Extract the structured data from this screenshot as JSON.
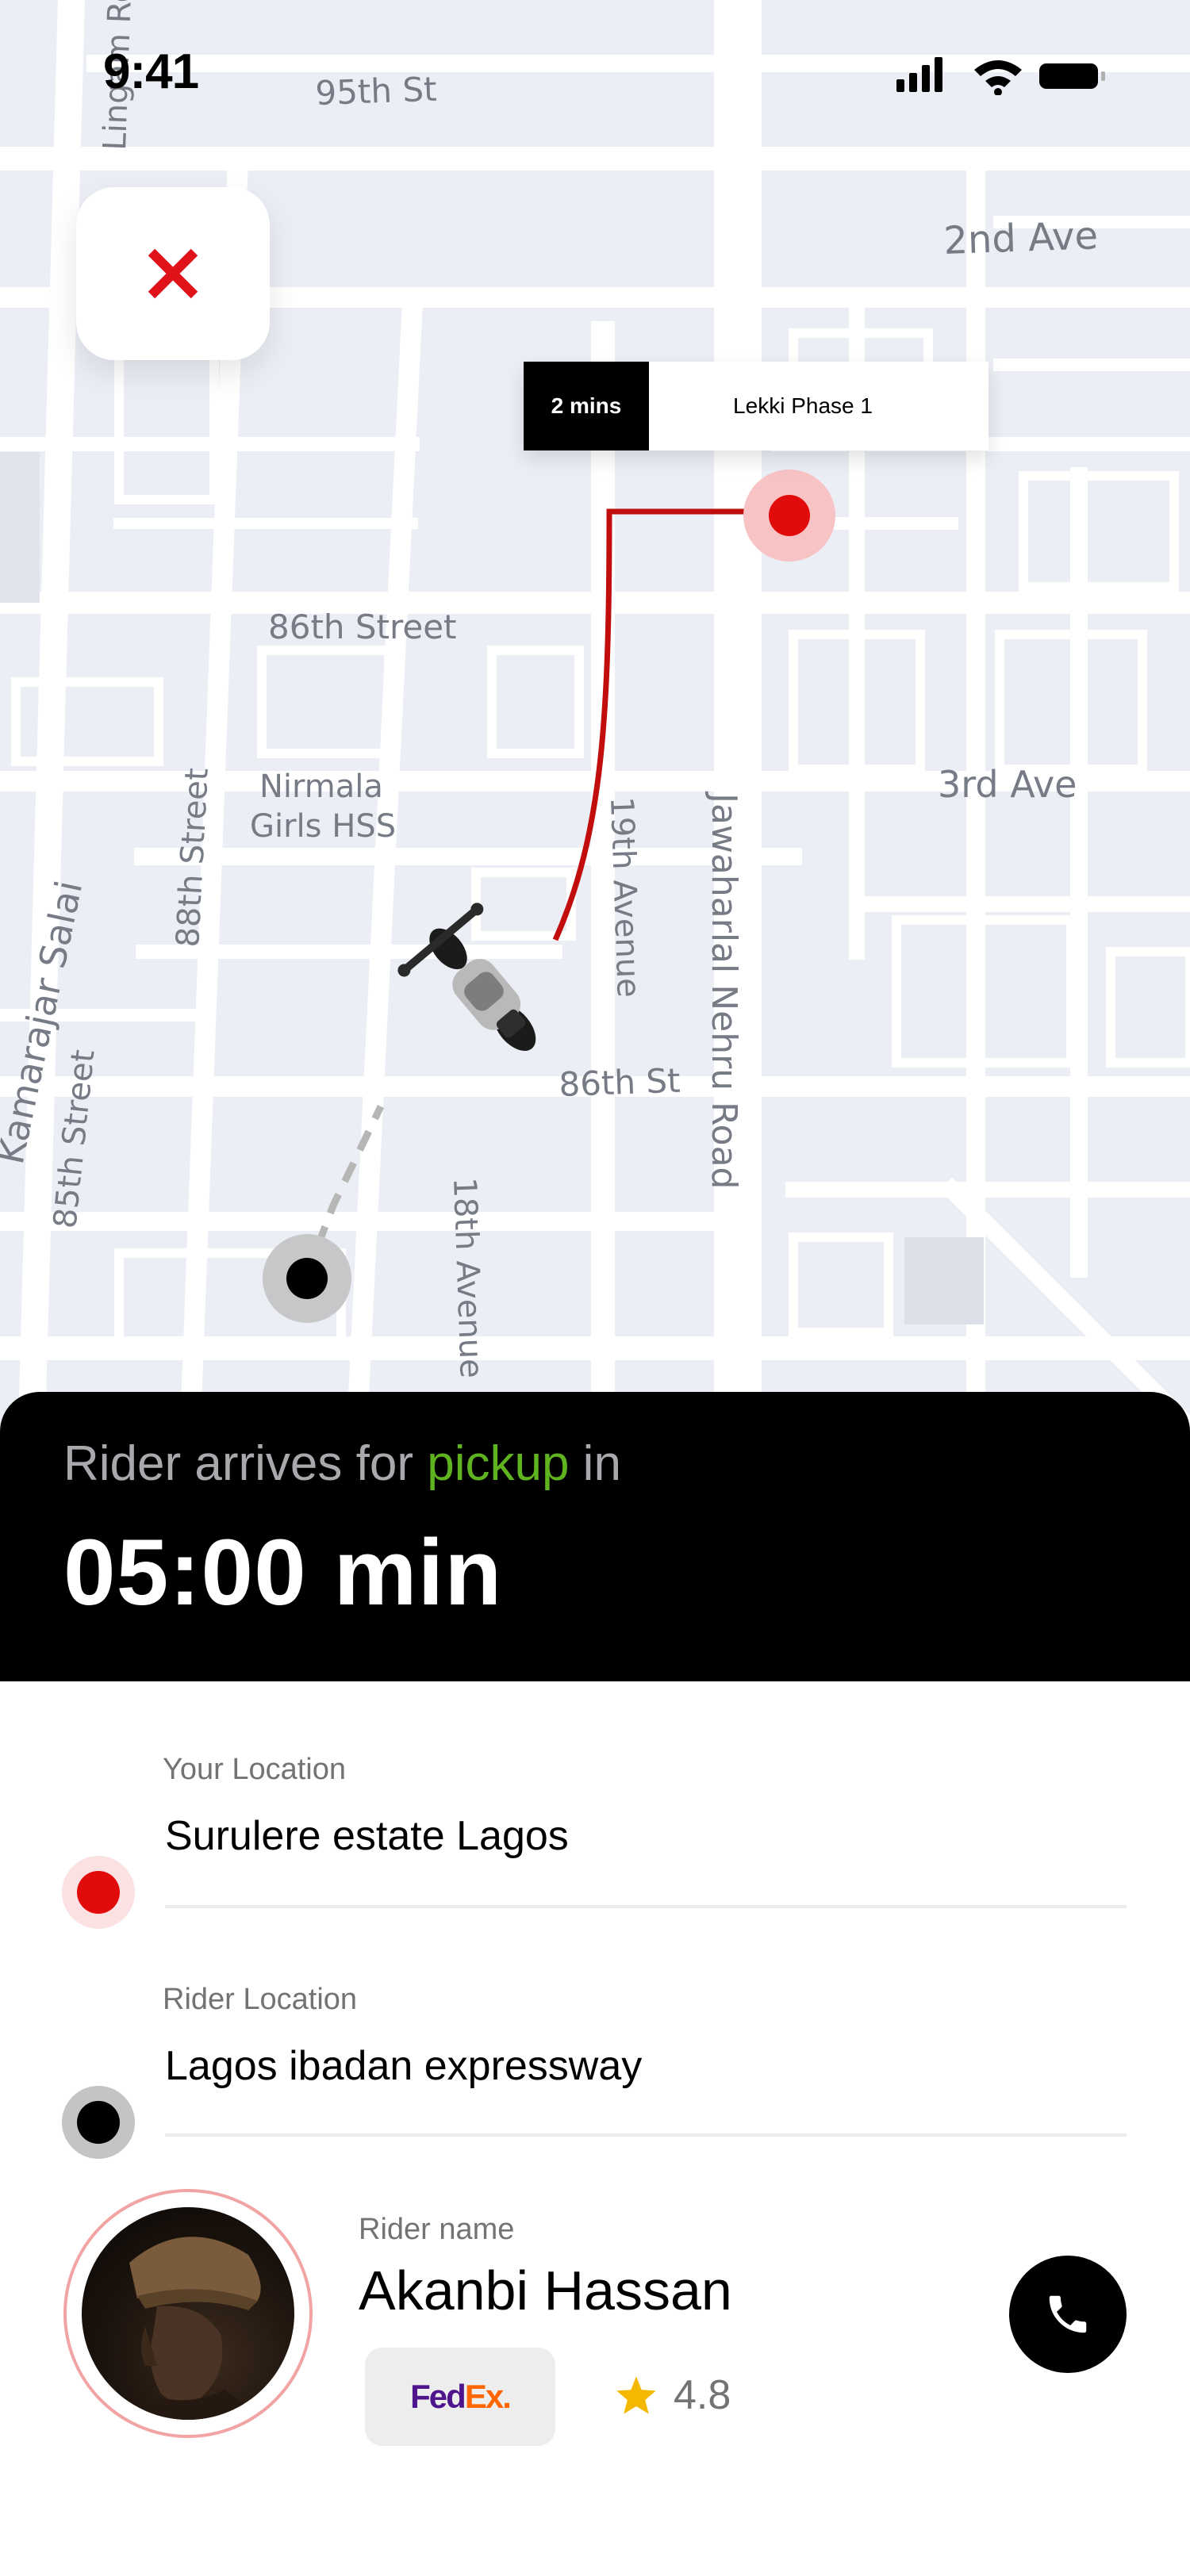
{
  "status_bar": {
    "time": "9:41",
    "icons": [
      "signal-icon",
      "wifi-icon",
      "battery-icon"
    ]
  },
  "map": {
    "streets": [
      "95th St",
      "2nd Ave",
      "86th Street",
      "3rd Ave",
      "Nirmala",
      "Girls HSS",
      "88th Street",
      "19th Avenue",
      "Jawaharlal Nehru Road",
      "86th St",
      "85th Street",
      "18th Avenue",
      "Kamarajar Salai",
      "Lingam Ro"
    ],
    "eta_tag": {
      "time": "2 mins",
      "place": "Lekki Phase 1"
    },
    "route_color": "#d10a0a",
    "destination_color": "#e10b0b",
    "rider_marker_color": "#000000"
  },
  "close_button": {
    "icon": "close-icon",
    "color": "#e0131b"
  },
  "banner": {
    "prefix": "Rider arrives for ",
    "accent": "pickup",
    "suffix": " in",
    "eta": "05:00 min",
    "accent_color": "#5fb31f"
  },
  "locations": [
    {
      "caption": "Your Location",
      "value": "Surulere estate Lagos",
      "dot_color": "#e10b0b"
    },
    {
      "caption": "Rider Location",
      "value": "Lagos ibadan expressway",
      "dot_color": "#000000"
    }
  ],
  "rider": {
    "caption": "Rider name",
    "name": "Akanbi Hassan",
    "company_fed": "Fed",
    "company_ex": "Ex",
    "company_dot": ".",
    "rating": "4.8",
    "star_color": "#f5b800"
  },
  "call_button": {
    "icon": "phone-icon"
  }
}
